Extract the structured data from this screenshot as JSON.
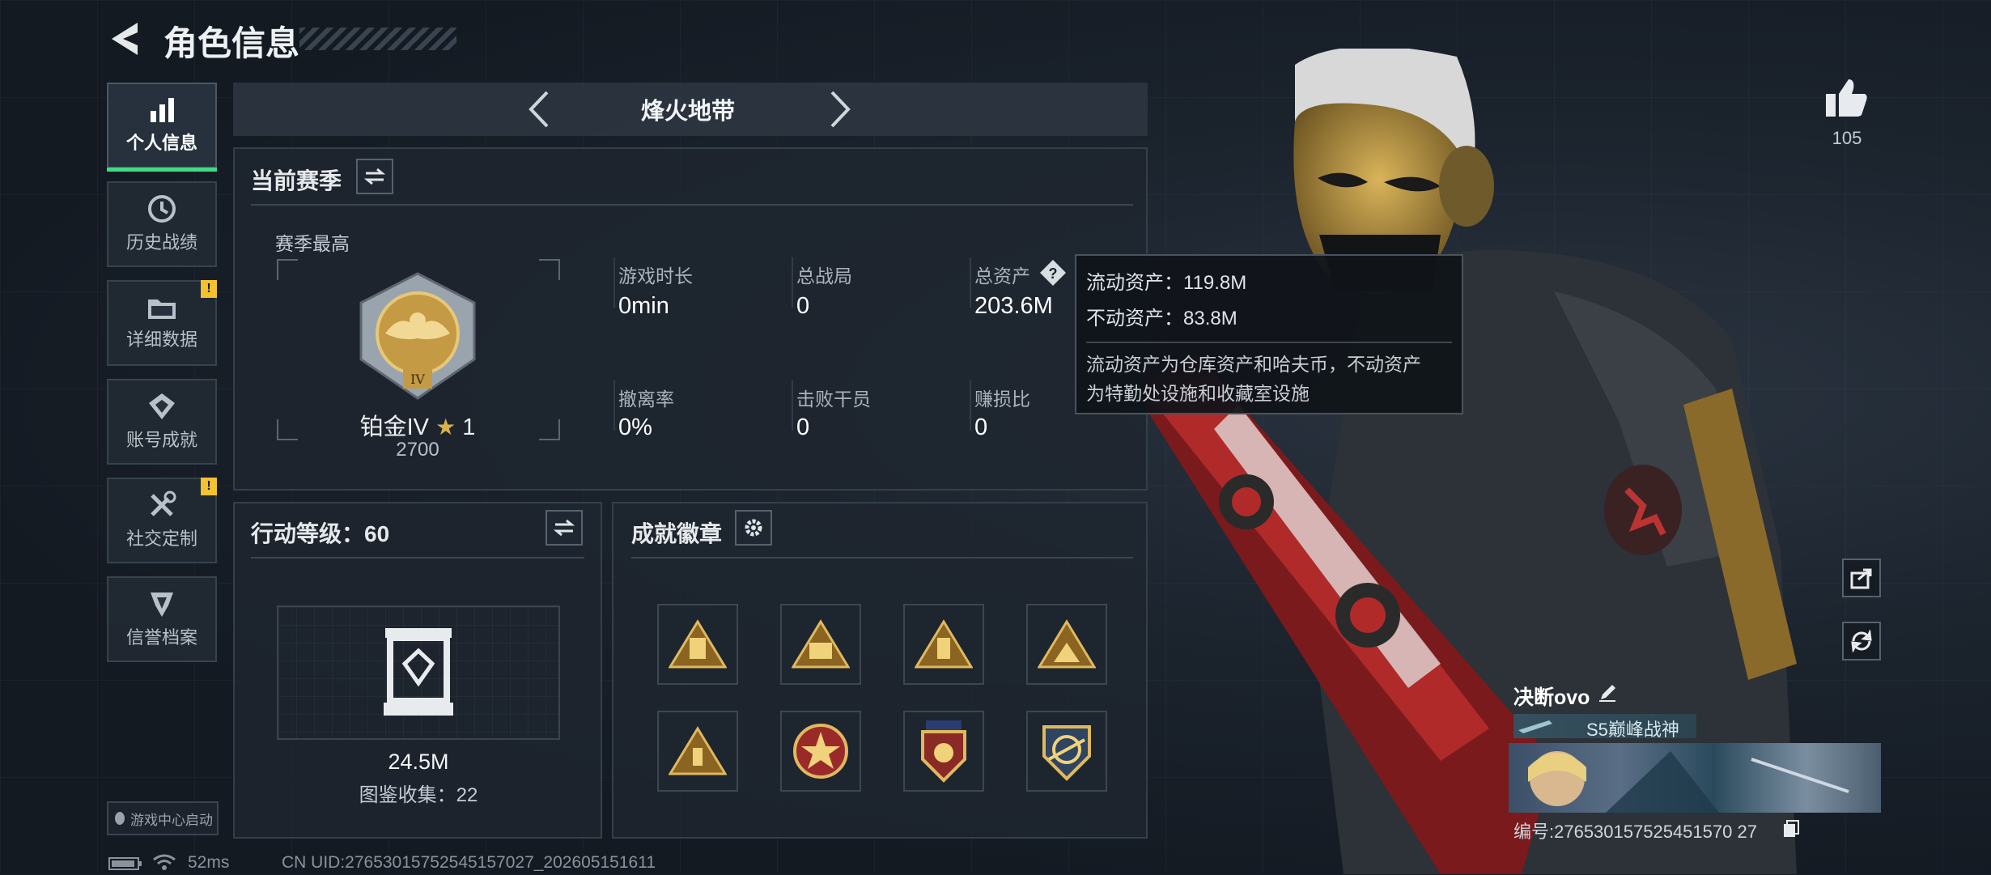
{
  "header": {
    "title": "角色信息"
  },
  "sidebar": {
    "items": [
      {
        "label": "个人信息",
        "active": true,
        "warn": false
      },
      {
        "label": "历史战绩",
        "active": false,
        "warn": false
      },
      {
        "label": "详细数据",
        "active": false,
        "warn": true
      },
      {
        "label": "账号成就",
        "active": false,
        "warn": false
      },
      {
        "label": "社交定制",
        "active": false,
        "warn": true
      },
      {
        "label": "信誉档案",
        "active": false,
        "warn": false
      }
    ],
    "warn_mark": "!",
    "game_center": "游戏中心启动"
  },
  "mode_selector": {
    "label": "烽火地带"
  },
  "season": {
    "title": "当前赛季",
    "best_label": "赛季最高",
    "rank_name": "铂金IV",
    "rank_stars": "1",
    "rank_score": "2700",
    "rank_numeral": "IV",
    "stats": [
      {
        "label": "游戏时长",
        "value": "0min"
      },
      {
        "label": "总战局",
        "value": "0"
      },
      {
        "label": "总资产",
        "value": "203.6M"
      },
      {
        "label": "撤离率",
        "value": "0%"
      },
      {
        "label": "击败干员",
        "value": "0"
      },
      {
        "label": "赚损比",
        "value": "0"
      }
    ]
  },
  "tooltip": {
    "liquid": "流动资产：119.8M",
    "fixed": "不动资产：83.8M",
    "desc_line1": "流动资产为仓库资产和哈夫币，不动资产",
    "desc_line2": "为特勤处设施和收藏室设施"
  },
  "action_level": {
    "title": "行动等级：60",
    "value": "24.5M",
    "collection": "图鉴收集：22"
  },
  "achievements": {
    "title": "成就徽章"
  },
  "profile": {
    "likes": "105",
    "name": "决断ovo",
    "title_badge": "S5巅峰战神",
    "id_text": "编号:276530157525451570 27"
  },
  "status_bar": {
    "ping": "52ms",
    "uid": "CN UID:27653015752545157027_202605151611"
  },
  "colors": {
    "accent_green": "#3ddc84",
    "warn_yellow": "#f2c230",
    "gold": "#c9a24a"
  }
}
